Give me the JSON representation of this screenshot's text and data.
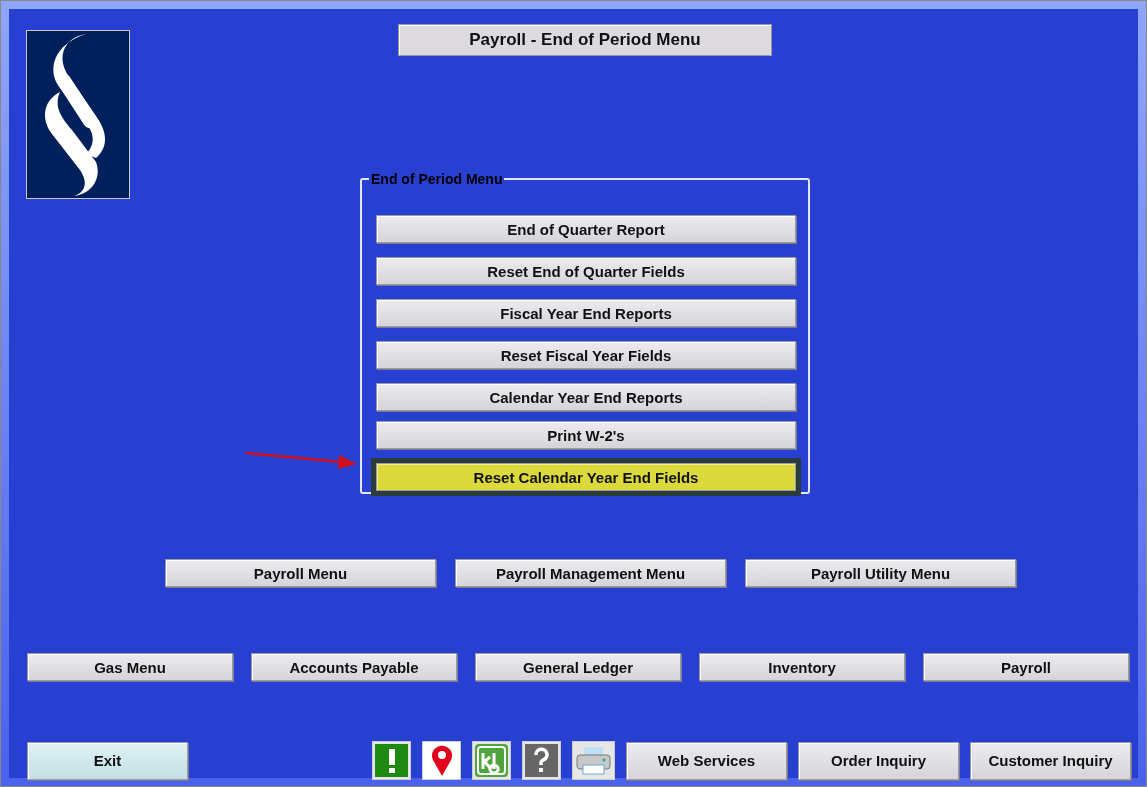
{
  "title": "Payroll - End of Period Menu",
  "group": {
    "legend": "End of Period Menu",
    "items": [
      {
        "label": "End of Quarter Report",
        "selected": false
      },
      {
        "label": "Reset End of Quarter Fields",
        "selected": false
      },
      {
        "label": "Fiscal Year End Reports",
        "selected": false
      },
      {
        "label": "Reset Fiscal Year Fields",
        "selected": false
      },
      {
        "label": "Calendar Year End Reports",
        "selected": false
      },
      {
        "label": "Print  W-2's",
        "selected": false
      },
      {
        "label": "Reset Calendar Year End Fields",
        "selected": true
      }
    ]
  },
  "submenus": [
    "Payroll Menu",
    "Payroll Management Menu",
    "Payroll Utility Menu"
  ],
  "modules": [
    "Gas Menu",
    "Accounts Payable",
    "General Ledger",
    "Inventory",
    "Payroll"
  ],
  "exit": "Exit",
  "footer_buttons": [
    "Web Services",
    "Order Inquiry",
    "Customer Inquiry"
  ]
}
